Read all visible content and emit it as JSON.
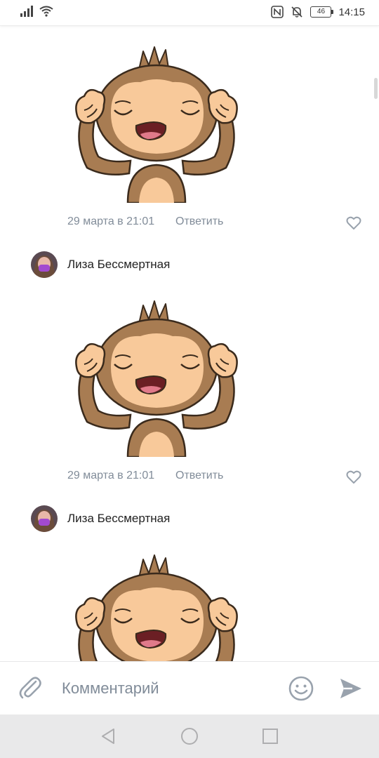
{
  "status": {
    "time": "14:15",
    "battery": "46",
    "icons": [
      "signal-icon",
      "wifi-icon",
      "nfc-icon",
      "bell-off-icon",
      "battery-icon"
    ]
  },
  "comments": [
    {
      "date": "29 марта в 21:01",
      "reply": "Ответить"
    },
    {
      "author": "Лиза Бессмертная",
      "date": "29 марта в 21:01",
      "reply": "Ответить"
    },
    {
      "author": "Лиза Бессмертная"
    }
  ],
  "composer": {
    "placeholder": "Комментарий"
  },
  "colors": {
    "secondary_text": "#818c99",
    "icon_gray": "#99a2ad",
    "nav_bg": "#e9e9ea"
  }
}
